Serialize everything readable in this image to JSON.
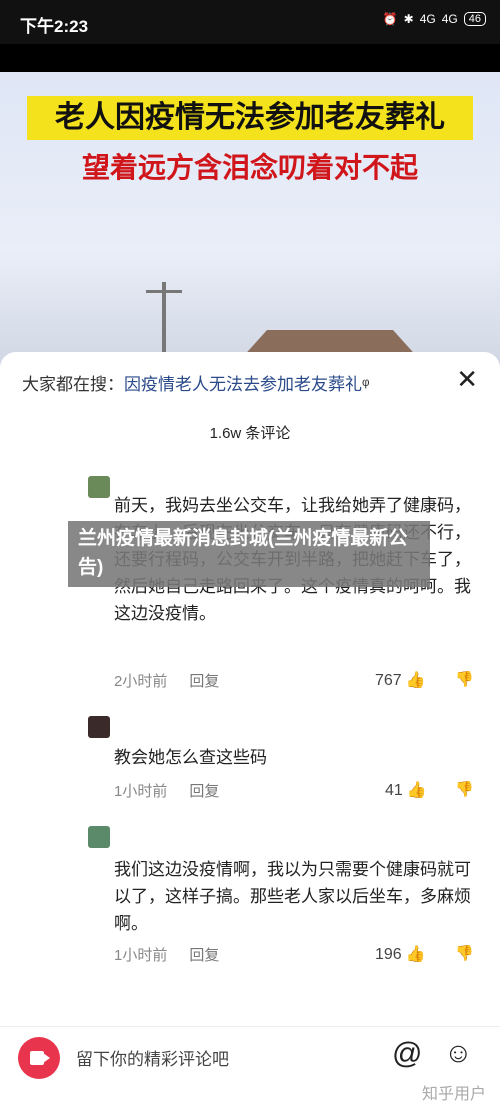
{
  "statusbar": {
    "time": "下午2:23",
    "battery": "46",
    "network_a": "4G",
    "network_b": "4G"
  },
  "video": {
    "title_line1": "老人因疫情无法参加老友葬礼",
    "title_line2": "望着远方含泪念叨着对不起"
  },
  "sheet": {
    "search_prefix": "大家都在搜：",
    "search_query": "因疫情老人无法去参加老友葬礼",
    "comment_count": "1.6w 条评论"
  },
  "overlay": {
    "text": "兰州疫情最新消息封城(兰州疫情最新公告)"
  },
  "comments": [
    {
      "text": "前天，我妈去坐公交车，让我给她弄了健康码，在车上，后现在坐公交车，只有健康码还不行，还要行程码，公交车开到半路，把她赶下车了，然后她自己走路回来了。这个疫情真的呵呵。我这边没疫情。",
      "time": "2小时前",
      "reply": "回复",
      "likes": "767"
    },
    {
      "text": "教会她怎么查这些码",
      "time": "1小时前",
      "reply": "回复",
      "likes": "41"
    },
    {
      "text": "我们这边没疫情啊，我以为只需要个健康码就可以了，这样子搞。那些老人家以后坐车，多麻烦啊。",
      "time": "1小时前",
      "reply": "回复",
      "likes": "196"
    }
  ],
  "bottombar": {
    "placeholder": "留下你的精彩评论吧",
    "at": "@",
    "emoji": "☺"
  },
  "watermark": "知乎用户"
}
